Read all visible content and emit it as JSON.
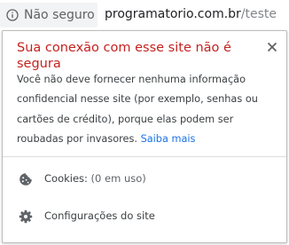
{
  "omnibox": {
    "security_chip_label": "Não seguro",
    "url_host": "programatorio.com.br",
    "url_path": "/teste"
  },
  "popup": {
    "title": "Sua conexão com esse site não é segura",
    "body_text": "Você não deve fornecer nenhuma informação confidencial nesse site (por exemplo, senhas ou cartões de crédito), porque elas podem ser roubadas por invasores. ",
    "learn_more": "Saiba mais",
    "cookies": {
      "label": "Cookies:",
      "detail": " (0 em uso)",
      "icon": "cookie-icon"
    },
    "site_settings": {
      "label": "Configurações do site",
      "icon": "gear-icon"
    }
  },
  "colors": {
    "warning_title": "#c5221f",
    "link": "#1a73e8",
    "chip_background": "#f1f3f4"
  }
}
